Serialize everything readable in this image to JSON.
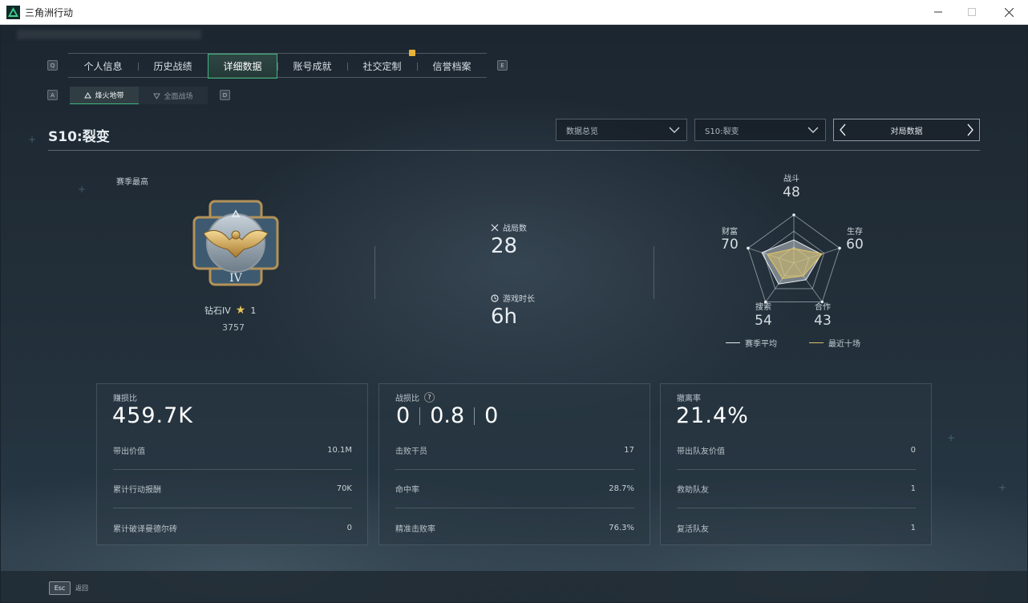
{
  "window": {
    "title": "三角洲行动"
  },
  "tabs": {
    "left_key": "Q",
    "right_key": "E",
    "items": [
      {
        "label": "个人信息"
      },
      {
        "label": "历史战绩"
      },
      {
        "label": "详细数据",
        "active": true
      },
      {
        "label": "账号成就"
      },
      {
        "label": "社交定制",
        "badge": true
      },
      {
        "label": "信誉档案"
      }
    ]
  },
  "subtabs": {
    "left_key": "A",
    "right_key": "D",
    "items": [
      {
        "label": "烽火地带",
        "active": true
      },
      {
        "label": "全面战场"
      }
    ]
  },
  "season": {
    "title": "S10:裂变",
    "filters": {
      "mode": "数据总览",
      "season": "S10:裂变"
    },
    "nav_label": "对局数据"
  },
  "rank": {
    "caption": "赛季最高",
    "tier": "钻石IV",
    "stars": "1",
    "score": "3757",
    "medal_numeral": "IV"
  },
  "matches": {
    "games_label": "战局数",
    "games_value": "28",
    "time_label": "游戏时长",
    "time_value": "6h"
  },
  "radar": {
    "axes": [
      {
        "label": "战斗",
        "value": "48"
      },
      {
        "label": "生存",
        "value": "60"
      },
      {
        "label": "合作",
        "value": "43"
      },
      {
        "label": "搜索",
        "value": "54"
      },
      {
        "label": "财富",
        "value": "70"
      }
    ],
    "season_avg": [
      0.48,
      0.6,
      0.43,
      0.54,
      0.7
    ],
    "recent10": [
      0.3,
      0.62,
      0.33,
      0.4,
      0.58
    ],
    "legend_avg": "赛季平均",
    "legend_recent": "最近十场",
    "colors": {
      "avg": "#e8ecef",
      "recent": "#d8c06a"
    }
  },
  "cards": {
    "profit": {
      "label": "赚损比",
      "value": "459.7K",
      "rows": [
        {
          "label": "带出价值",
          "value": "10.1M"
        },
        {
          "label": "累计行动报酬",
          "value": "70K"
        },
        {
          "label": "累计破译曼德尔砖",
          "value": "0"
        }
      ]
    },
    "combat": {
      "label": "战损比",
      "help": "?",
      "ratio": [
        "0",
        "0.8",
        "0"
      ],
      "rows": [
        {
          "label": "击败干员",
          "value": "17"
        },
        {
          "label": "命中率",
          "value": "28.7%"
        },
        {
          "label": "精准击败率",
          "value": "76.3%"
        }
      ]
    },
    "extract": {
      "label": "撤离率",
      "value": "21.4%",
      "rows": [
        {
          "label": "带出队友价值",
          "value": "0"
        },
        {
          "label": "救助队友",
          "value": "1"
        },
        {
          "label": "复活队友",
          "value": "1"
        }
      ]
    }
  },
  "footer": {
    "esc_key": "Esc",
    "esc_label": "返回"
  },
  "theme": {
    "accent": "#3fb77d",
    "gold": "#e8b23a"
  }
}
